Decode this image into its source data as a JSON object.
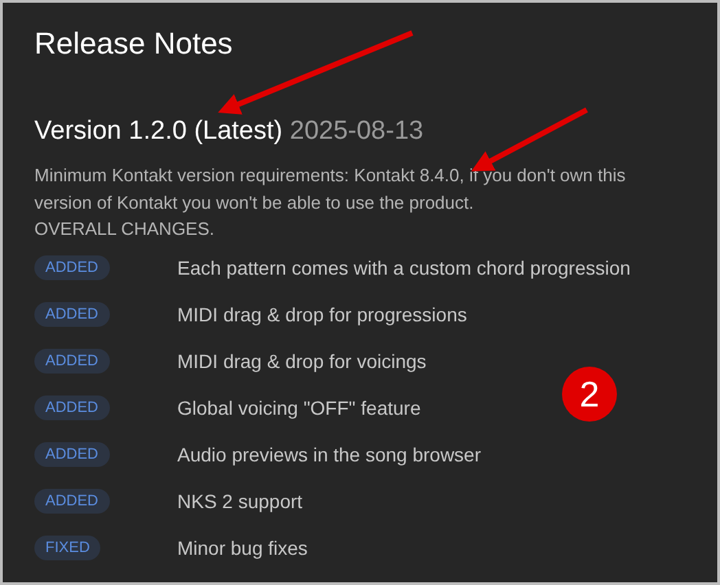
{
  "title": "Release Notes",
  "version": {
    "name": "Version 1.2.0 (Latest)",
    "date": "2025-08-13"
  },
  "description": "Minimum Kontakt version requirements: Kontakt 8.4.0, if you don't own this version of Kontakt you won't be able to use the product.",
  "section_heading": "OVERALL CHANGES.",
  "changes": [
    {
      "tag": "ADDED",
      "text": "Each pattern comes with a custom chord progression"
    },
    {
      "tag": "ADDED",
      "text": "MIDI drag & drop for progressions"
    },
    {
      "tag": "ADDED",
      "text": "MIDI drag & drop for voicings"
    },
    {
      "tag": "ADDED",
      "text": "Global voicing \"OFF\" feature"
    },
    {
      "tag": "ADDED",
      "text": "Audio previews in the song browser"
    },
    {
      "tag": "ADDED",
      "text": "NKS 2 support"
    },
    {
      "tag": "FIXED",
      "text": "Minor bug fixes"
    }
  ],
  "annotation_badge": "2"
}
